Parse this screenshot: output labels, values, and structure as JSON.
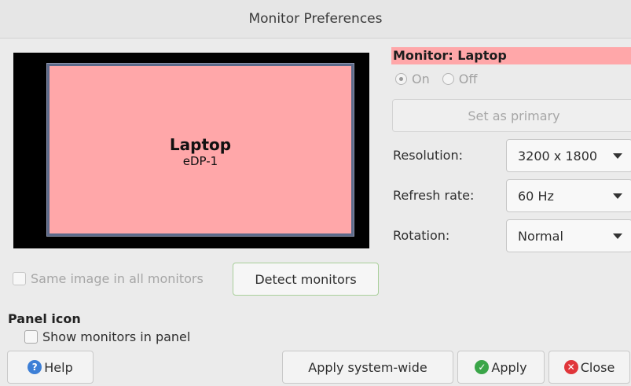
{
  "window": {
    "title": "Monitor Preferences"
  },
  "preview": {
    "monitor_name": "Laptop",
    "monitor_port": "eDP-1"
  },
  "monitor_panel": {
    "header": "Monitor: Laptop",
    "on_label": "On",
    "off_label": "Off",
    "selected": "On",
    "primary_button": "Set as primary",
    "resolution_label": "Resolution:",
    "resolution_value": "3200 x 1800",
    "refresh_label": "Refresh rate:",
    "refresh_value": "60 Hz",
    "rotation_label": "Rotation:",
    "rotation_value": "Normal"
  },
  "same_image_label": "Same image in all monitors",
  "detect_button": "Detect monitors",
  "panel_icon": {
    "title": "Panel icon",
    "show_label": "Show monitors in panel"
  },
  "footer": {
    "help": "Help",
    "apply_system_wide": "Apply system-wide",
    "apply": "Apply",
    "close": "Close"
  },
  "colors": {
    "monitor_fill": "#ffa7a9",
    "header_fill": "#ffa7a9",
    "help_icon": "#3d7fd6",
    "apply_icon": "#3aa548",
    "close_icon": "#e0353a"
  },
  "icons": [
    "help-icon",
    "check-icon",
    "close-icon",
    "dropdown-arrow-icon"
  ]
}
